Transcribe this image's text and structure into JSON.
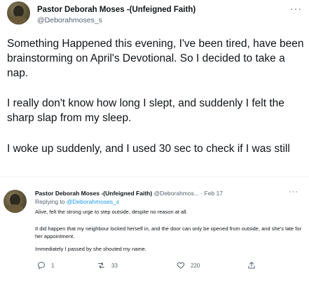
{
  "main_tweet": {
    "name": "Pastor Deborah Moses -(Unfeigned Faith)",
    "handle": "@Deborahmoses_s",
    "more": "···",
    "paragraphs": [
      "Something Happened this evening, I've been tired, have been brainstorming on April's Devotional. So I decided to take a nap.",
      "I really don't know how long I slept, and suddenly I felt the sharp slap from my sleep.",
      "I woke up suddenly, and I used 30 sec to check if I was still"
    ]
  },
  "reply": {
    "name": "Pastor Deborah Moses -(Unfeigned Faith)",
    "handle": "@Deborahmos...",
    "separator": "·",
    "date": "Feb 17",
    "more": "···",
    "replying_prefix": "Replying to",
    "replying_to": "@Deborahmoses_s",
    "paragraphs": [
      "Alive, felt the strong urge to step outside, despite no reason at all.",
      "It did happen that my neighbour locked herself in, and the door can only be opened from outside,  and she's late for her appointment.",
      "Immediately I passed by she shouted my name."
    ],
    "actions": {
      "reply_count": "1",
      "retweet_count": "33",
      "like_count": "220"
    }
  },
  "icons": {
    "reply": "comment-icon",
    "retweet": "retweet-icon",
    "like": "heart-icon",
    "share": "share-icon",
    "more": "more-icon"
  },
  "colors": {
    "text": "#0f1419",
    "secondary": "#536471",
    "link": "#1d9bf0",
    "divider": "#eff3f4"
  }
}
